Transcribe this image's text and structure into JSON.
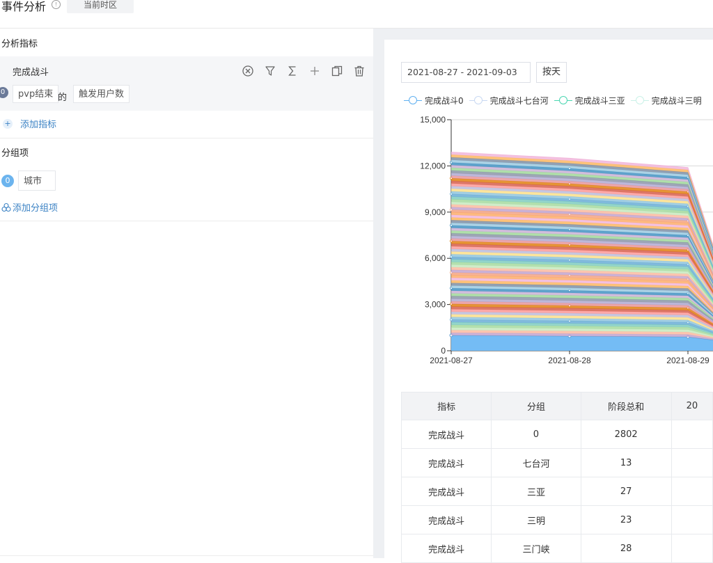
{
  "header": {
    "title": "事件分析",
    "info_icon": "info-icon",
    "timezone_label": "当前时区"
  },
  "left": {
    "metrics_title": "分析指标",
    "metric": {
      "name": "完成战斗",
      "index": "0",
      "event": "pvp结束",
      "of_text": "的",
      "measure": "触发用户数",
      "tools": [
        "close-circle-icon",
        "filter-icon",
        "sigma-icon",
        "plus-icon",
        "copy-icon",
        "trash-icon"
      ]
    },
    "add_metric": "添加指标",
    "group_title": "分组项",
    "group": {
      "index": "0",
      "field": "城市"
    },
    "add_group": "添加分组项"
  },
  "toolbar": {
    "date_range": "2021-08-27 - 2021-09-03",
    "granularity": "按天"
  },
  "legend": [
    {
      "name": "完成战斗0",
      "color": "#5fb0f0"
    },
    {
      "name": "完成战斗七台河",
      "color": "#c8d8f2"
    },
    {
      "name": "完成战斗三亚",
      "color": "#49d6b0"
    },
    {
      "name": "完成战斗三明",
      "color": "#c9f1e7"
    }
  ],
  "chart_data": {
    "type": "area",
    "stacked": true,
    "x": [
      "2021-08-27",
      "2021-08-28",
      "2021-08-29"
    ],
    "y_ticks": [
      "0",
      "3,000",
      "6,000",
      "9,000",
      "12,000",
      "15,000"
    ],
    "ylim": [
      0,
      15000
    ],
    "bottom_series": {
      "name": "完成战斗0",
      "values": [
        1000,
        950,
        900
      ]
    },
    "stack_total": [
      12900,
      12500,
      11900
    ],
    "x_extends_beyond_view": true
  },
  "table": {
    "headers": [
      "指标",
      "分组",
      "阶段总和",
      "20"
    ],
    "rows": [
      [
        "完成战斗",
        "0",
        "2802"
      ],
      [
        "完成战斗",
        "七台河",
        "13"
      ],
      [
        "完成战斗",
        "三亚",
        "27"
      ],
      [
        "完成战斗",
        "三明",
        "23"
      ],
      [
        "完成战斗",
        "三门峡",
        "28"
      ]
    ]
  }
}
